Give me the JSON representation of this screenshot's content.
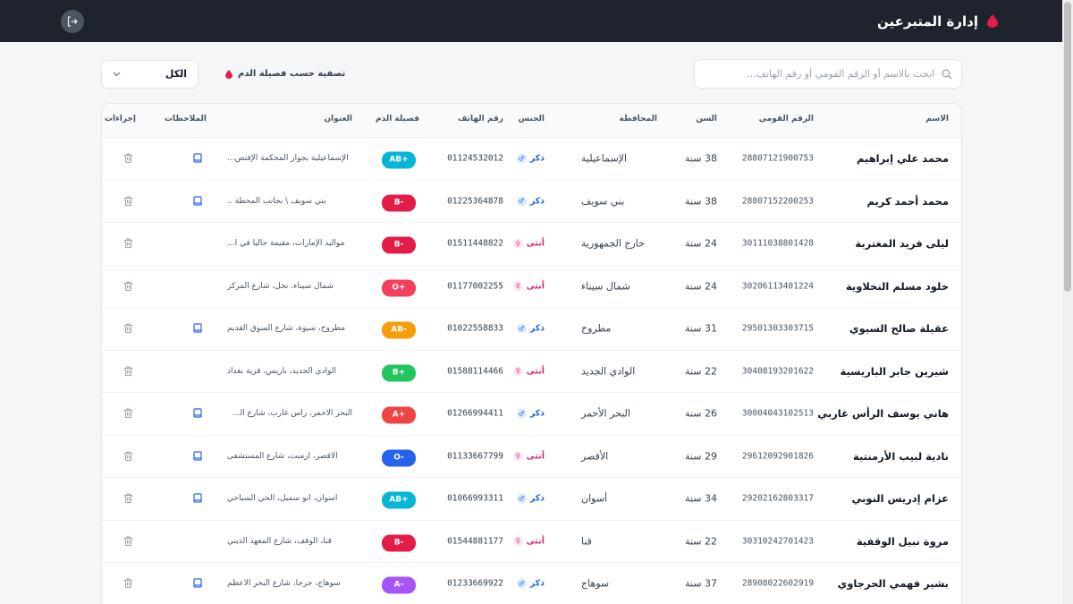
{
  "header": {
    "title": "إدارة المتبرعين",
    "brand_color": "#e11d48"
  },
  "toolbar": {
    "search_placeholder": "ابحث بالاسم أو الرقم القومي أو رقم الهاتف...",
    "filter_label": "تصفية حسب فصيلة الدم",
    "filter_value": "الكل"
  },
  "table": {
    "headers": {
      "name": "الاسم",
      "national_id": "الرقم القومي",
      "age": "السن",
      "governorate": "المحافظة",
      "gender": "الجنس",
      "phone": "رقم الهاتف",
      "blood": "فصيلة الدم",
      "address": "العنوان",
      "notes": "الملاحظات",
      "actions": "إجراءات"
    },
    "rows": [
      {
        "name": "محمد علي إبراهيم",
        "national_id": "28807121900753",
        "age": "38 سنة",
        "governorate": "الإسماعيلية",
        "gender": "ذكر",
        "gender_type": "male",
        "phone": "01124532012",
        "blood": "AB+",
        "blood_color": "#06b6d4",
        "address": "الإسماعيلية بجوار المحكمة الإقتص...",
        "has_note": true
      },
      {
        "name": "محمد أحمد كريم",
        "national_id": "28807152200253",
        "age": "38 سنة",
        "governorate": "بني سويف",
        "gender": "ذكر",
        "gender_type": "male",
        "phone": "01225364878",
        "blood": "B-",
        "blood_color": "#e11d48",
        "address": "بني سويف \\ بجانب المحطة ..",
        "has_note": true
      },
      {
        "name": "ليلى فريد المغتربة",
        "national_id": "30111038801428",
        "age": "24 سنة",
        "governorate": "خارج الجمهورية",
        "gender": "أنثى",
        "gender_type": "female",
        "phone": "01511448822",
        "blood": "B-",
        "blood_color": "#e11d48",
        "address": "مواليد الإمارات، مقيمة حالياً في ا...",
        "has_note": false
      },
      {
        "name": "خلود مسلم النخلاوية",
        "national_id": "30206113401224",
        "age": "24 سنة",
        "governorate": "شمال سيناء",
        "gender": "أنثى",
        "gender_type": "female",
        "phone": "01177002255",
        "blood": "O+",
        "blood_color": "#f43f5e",
        "address": "شمال سيناء، نخل، شارع المركز",
        "has_note": false
      },
      {
        "name": "عقيلة صالح السيوي",
        "national_id": "29501303303715",
        "age": "31 سنة",
        "governorate": "مطروح",
        "gender": "ذكر",
        "gender_type": "male",
        "phone": "01022558833",
        "blood": "AB-",
        "blood_color": "#f59e0b",
        "address": "مطروح، سيوة، شارع السوق القديم",
        "has_note": true
      },
      {
        "name": "شيرين جابر الباريسية",
        "national_id": "30408193201622",
        "age": "22 سنة",
        "governorate": "الوادي الجديد",
        "gender": "أنثى",
        "gender_type": "female",
        "phone": "01588114466",
        "blood": "B+",
        "blood_color": "#22c55e",
        "address": "الوادي الجديد، باريس، قرية بغداد",
        "has_note": false
      },
      {
        "name": "هاني يوسف الرأس غاربي",
        "national_id": "30004043102513",
        "age": "26 سنة",
        "governorate": "البحر الأحمر",
        "gender": "ذكر",
        "gender_type": "male",
        "phone": "01266994411",
        "blood": "A+",
        "blood_color": "#ef4444",
        "address": "البحر الأحمر، رأس غارب، شارع الم...",
        "has_note": true
      },
      {
        "name": "نادية لبيب الأرمنتية",
        "national_id": "29612092901826",
        "age": "29 سنة",
        "governorate": "الأقصر",
        "gender": "أنثى",
        "gender_type": "female",
        "phone": "01133667799",
        "blood": "O-",
        "blood_color": "#2563eb",
        "address": "الأقصر، أرمنت، شارع المستشفى",
        "has_note": true
      },
      {
        "name": "عزام إدريس النوبي",
        "national_id": "29202162803317",
        "age": "34 سنة",
        "governorate": "أسوان",
        "gender": "ذكر",
        "gender_type": "male",
        "phone": "01066993311",
        "blood": "AB+",
        "blood_color": "#06b6d4",
        "address": "أسوان، أبو سمبل، الحي السياحي",
        "has_note": true
      },
      {
        "name": "مروة نبيل الوقفية",
        "national_id": "30310242701423",
        "age": "22 سنة",
        "governorate": "قنا",
        "gender": "أنثى",
        "gender_type": "female",
        "phone": "01544881177",
        "blood": "B-",
        "blood_color": "#e11d48",
        "address": "قنا، الوقف، شارع المعهد الديني",
        "has_note": false
      },
      {
        "name": "بشير فهمي الجرجاوي",
        "national_id": "28908022602919",
        "age": "37 سنة",
        "governorate": "سوهاج",
        "gender": "ذكر",
        "gender_type": "male",
        "phone": "01233669922",
        "blood": "A-",
        "blood_color": "#a855f7",
        "address": "سوهاج، جرجا، شارع البحر الأعظم",
        "has_note": true
      }
    ]
  }
}
